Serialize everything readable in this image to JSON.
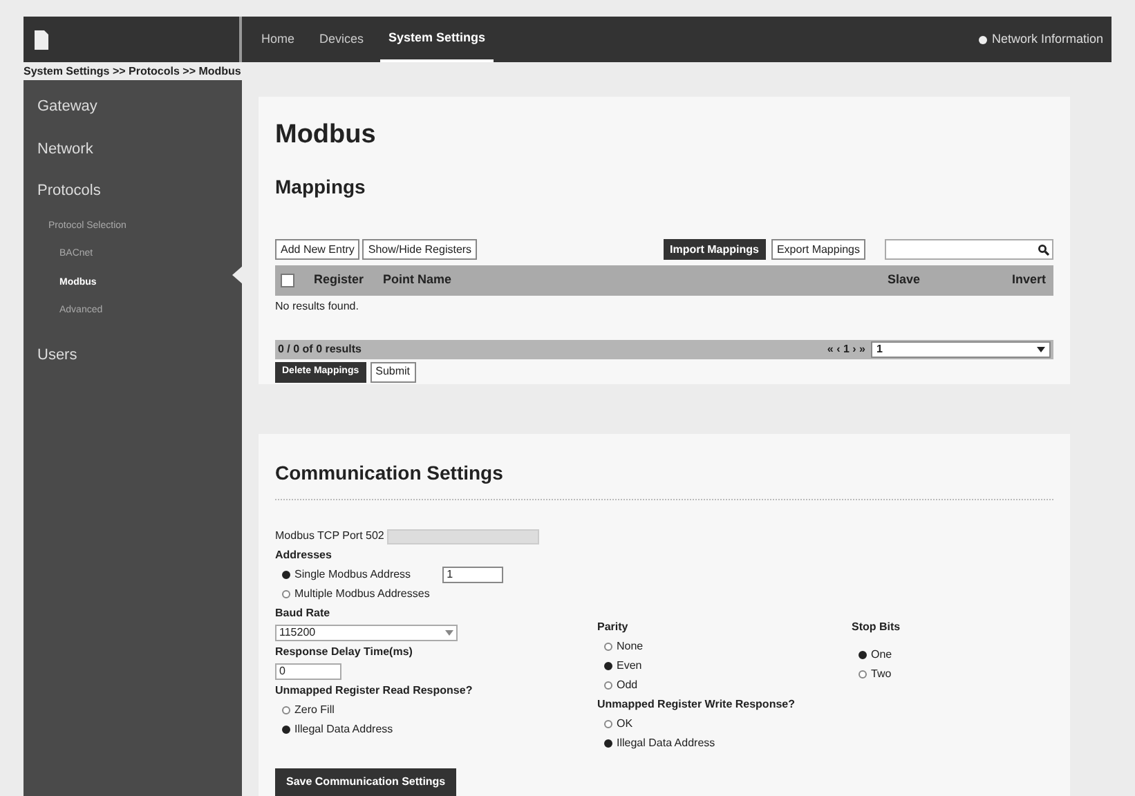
{
  "nav": {
    "tabs": [
      {
        "label": "Home",
        "selected": false
      },
      {
        "label": "Devices",
        "selected": false
      },
      {
        "label": "System Settings",
        "selected": true
      }
    ],
    "info_link": "Network Information"
  },
  "breadcrumb": "System Settings >> Protocols >> Modbus",
  "sidebar": {
    "items": [
      {
        "label": "Gateway",
        "selected": false
      },
      {
        "label": "Network",
        "selected": false
      },
      {
        "label": "Protocols",
        "selected": false,
        "children": [
          {
            "label": "Protocol Selection",
            "selected": false
          },
          {
            "label": "BACnet",
            "selected": false
          },
          {
            "label": "Modbus",
            "selected": true
          },
          {
            "label": "Advanced",
            "selected": false
          }
        ]
      },
      {
        "label": "Users",
        "selected": false
      }
    ]
  },
  "mappings_panel": {
    "title": "Modbus",
    "subtitle": "Mappings",
    "buttons_left": [
      "Add New Entry",
      "Show/Hide Registers"
    ],
    "import_button": "Import Mappings",
    "export_button": "Export Mappings",
    "select_all_checked": false,
    "columns": [
      "Register",
      "Point Name",
      "Slave",
      "Invert"
    ],
    "empty_text": "No results found.",
    "results": "0 / 0 of 0 results",
    "pager": "« ‹ 1 › »",
    "page_select": "1",
    "delete_button": "Delete Mappings",
    "submit_button": "Submit"
  },
  "comm_panel": {
    "title": "Communication Settings",
    "tcp_port_label": "Modbus TCP Port 502",
    "addresses_label": "Addresses",
    "addresses": [
      {
        "label": "Single Modbus Address",
        "selected": true
      },
      {
        "label": "Multiple Modbus Addresses",
        "selected": false
      }
    ],
    "address_value": "1",
    "baud_label": "Baud Rate",
    "baud_value": "115200",
    "delay_label": "Response Delay Time(ms)",
    "delay_value": "0",
    "read_label": "Unmapped Register Read Response?",
    "read_options": [
      {
        "label": "Zero Fill",
        "selected": false
      },
      {
        "label": "Illegal Data Address",
        "selected": true
      }
    ],
    "parity_label": "Parity",
    "parity": [
      {
        "label": "None",
        "selected": false
      },
      {
        "label": "Even",
        "selected": true
      },
      {
        "label": "Odd",
        "selected": false
      }
    ],
    "write_label": "Unmapped Register Write Response?",
    "write_options": [
      {
        "label": "OK",
        "selected": false
      },
      {
        "label": "Illegal Data Address",
        "selected": true
      }
    ],
    "stop_label": "Stop Bits",
    "stop": [
      {
        "label": "One",
        "selected": true
      },
      {
        "label": "Two",
        "selected": false
      }
    ],
    "save_button": "Save Communication Settings"
  }
}
